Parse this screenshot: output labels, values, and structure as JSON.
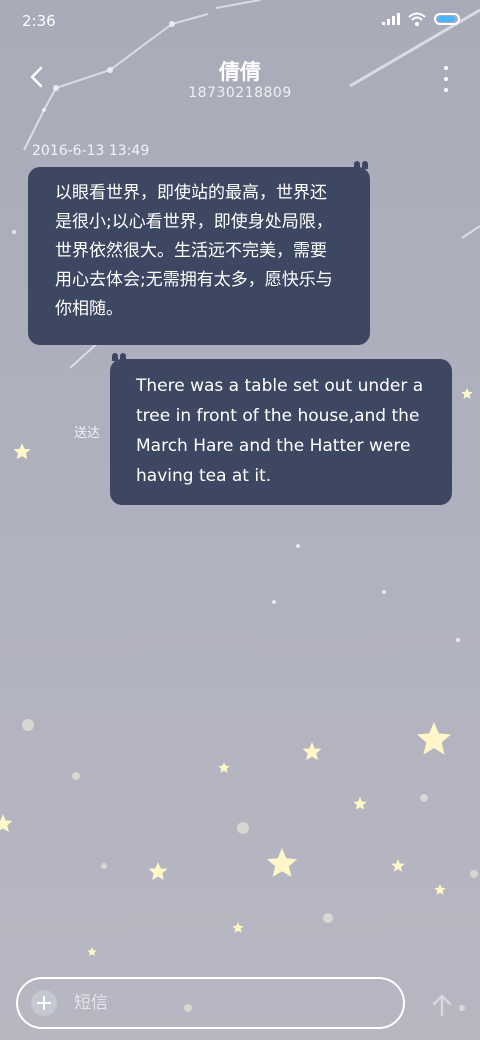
{
  "status_bar": {
    "time": "2:36"
  },
  "header": {
    "contact_name": "倩倩",
    "phone_number": "18730218809"
  },
  "conversation": {
    "timestamp": "2016-6-13 13:49",
    "messages": [
      {
        "direction": "incoming",
        "text": "以眼看世界，即使站的最高，世界还是很小;以心看世界，即使身处局限，世界依然很大。生活远不完美，需要用心去体会;无需拥有太多，愿快乐与你相随。"
      },
      {
        "direction": "outgoing",
        "text": "There was a table set out under a tree in front of the house,and the March Hare and the Hatter were having tea at it.",
        "status": "送达"
      }
    ]
  },
  "composer": {
    "placeholder": "短信"
  },
  "icons": {
    "back": "chevron-left-icon",
    "more": "more-vertical-icon",
    "add": "plus-icon",
    "send": "arrow-up-icon",
    "signal": "signal-icon",
    "wifi": "wifi-icon",
    "battery": "battery-icon"
  },
  "colors": {
    "bubble": "#3e4762",
    "background": "#acaebb",
    "battery_fill": "#4fb4ff",
    "star": "#fff7c8"
  }
}
